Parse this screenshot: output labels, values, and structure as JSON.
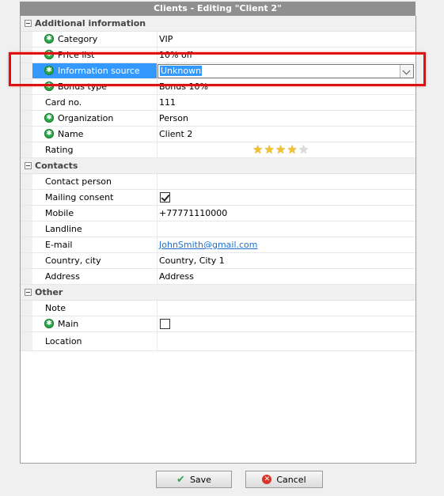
{
  "window": {
    "title": "Clients - Editing \"Client 2\""
  },
  "sections": {
    "additional": {
      "title": "Additional information",
      "rows": {
        "category": {
          "label": "Category",
          "value": "VIP"
        },
        "price_list": {
          "label": "Price list",
          "value": "10% off"
        },
        "info_source": {
          "label": "Information source",
          "value": "Unknown"
        },
        "bonus_type": {
          "label": "Bonus type",
          "value": "Bonus 10%"
        },
        "card_no": {
          "label": "Card no.",
          "value": "111"
        },
        "organization": {
          "label": "Organization",
          "value": "Person"
        },
        "name": {
          "label": "Name",
          "value": "Client 2"
        },
        "rating": {
          "label": "Rating",
          "stars": 4,
          "max_stars": 5
        }
      }
    },
    "contacts": {
      "title": "Contacts",
      "rows": {
        "contact_person": {
          "label": "Contact person",
          "value": ""
        },
        "mailing_consent": {
          "label": "Mailing consent",
          "checked": true
        },
        "mobile": {
          "label": "Mobile",
          "value": "+77771110000"
        },
        "landline": {
          "label": "Landline",
          "value": ""
        },
        "email": {
          "label": "E-mail",
          "value": "JohnSmith@gmail.com"
        },
        "country_city": {
          "label": "Country, city",
          "value": "Country, City 1"
        },
        "address": {
          "label": "Address",
          "value": "Address"
        }
      }
    },
    "other": {
      "title": "Other",
      "rows": {
        "note": {
          "label": "Note",
          "value": ""
        },
        "main": {
          "label": "Main",
          "checked": false
        },
        "location": {
          "label": "Location",
          "value": ""
        }
      }
    }
  },
  "buttons": {
    "save": "Save",
    "cancel": "Cancel"
  },
  "colors": {
    "selection": "#3399ff",
    "required_icon": "#2da84a",
    "highlight": "#e01010"
  }
}
